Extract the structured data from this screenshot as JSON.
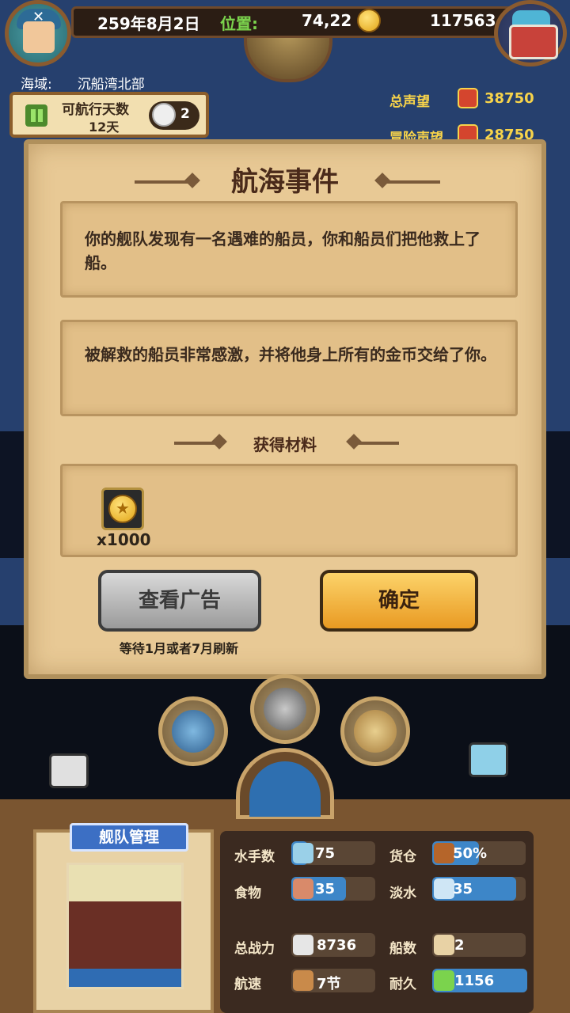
{
  "header": {
    "date": "259年8月2日",
    "position_label": "位置:",
    "position_value": "74,22",
    "gold": "117563"
  },
  "region": {
    "label": "海域:",
    "value": "沉船湾北部"
  },
  "sailing": {
    "days_label": "可航行天数",
    "days_value": "12天",
    "speed_multiplier": "2"
  },
  "reputation": {
    "total_label": "总声望",
    "total_value": "38750",
    "adventure_label": "冒险声望",
    "adventure_value": "28750"
  },
  "dialog": {
    "title": "航海事件",
    "message1": "你的舰队发现有一名遇难的船员，你和船员们把他救上了船。",
    "message2": "被解救的船员非常感激，并将他身上所有的金币交给了你。",
    "reward_title": "获得材料",
    "reward_qty": "x1000",
    "ad_button": "查看广告",
    "confirm_button": "确定",
    "refresh_note": "等待1月或者7月刷新"
  },
  "fleet": {
    "title": "舰队管理"
  },
  "stats": [
    {
      "label": "水手数",
      "value": "75",
      "fill": 0.2
    },
    {
      "label": "货仓",
      "value": "50%",
      "fill": 0.5
    },
    {
      "label": "食物",
      "value": "35",
      "fill": 0.65
    },
    {
      "label": "淡水",
      "value": "35",
      "fill": 0.9
    },
    {
      "label": "总战力",
      "value": "8736",
      "fill": 0
    },
    {
      "label": "船数",
      "value": "2",
      "fill": 0
    },
    {
      "label": "航速",
      "value": "7节",
      "fill": 0
    },
    {
      "label": "耐久",
      "value": "1156",
      "fill": 1.0
    }
  ],
  "colors": {
    "sea": "#26406e",
    "accent_green": "#7bd34d",
    "accent_gold": "#f7d34a",
    "bar_blue": "#3d86c8"
  }
}
